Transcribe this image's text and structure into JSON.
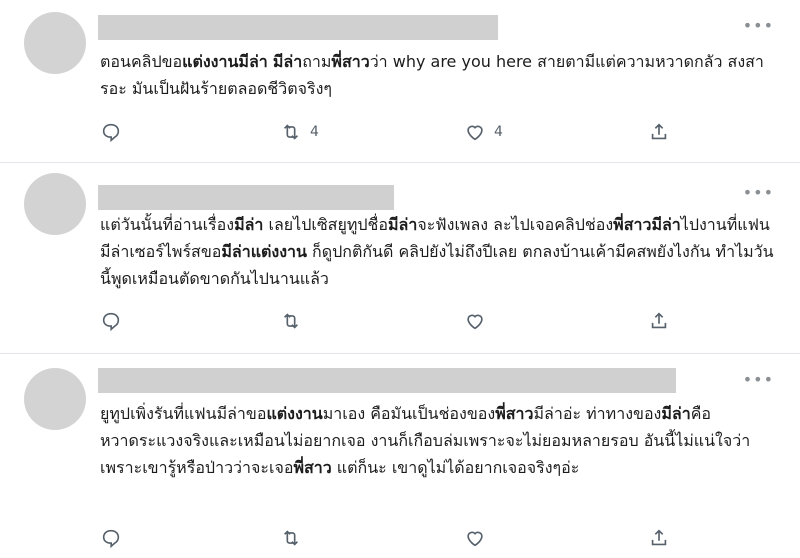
{
  "tweets": [
    {
      "segments": [
        {
          "t": "ตอนคลิปขอ",
          "b": false
        },
        {
          "t": "แต่งงาน",
          "b": true
        },
        {
          "t": "มีล่า",
          "b": true
        },
        {
          "t": " ",
          "b": false
        },
        {
          "t": "มีล่า",
          "b": true
        },
        {
          "t": "ถาม",
          "b": false
        },
        {
          "t": "พี่สาว",
          "b": true
        },
        {
          "t": "ว่า why are you here สายตามีแต่ความหวาดกลัว สงสารอะ มันเป็นฝันร้ายตลอดชีวิตจริงๆ",
          "b": false
        }
      ],
      "reply_count": "",
      "retweet_count": "4",
      "like_count": "4"
    },
    {
      "segments": [
        {
          "t": "แต่วันนั้นที่อ่านเรื่อง",
          "b": false
        },
        {
          "t": "มีล่า",
          "b": true
        },
        {
          "t": " เลยไปเซิสยูทูปชื่อ",
          "b": false
        },
        {
          "t": "มีล่า",
          "b": true
        },
        {
          "t": "จะฟังเพลง ละไปเจอคลิปช่อง",
          "b": false
        },
        {
          "t": "พี่สาว",
          "b": true
        },
        {
          "t": "มีล่า",
          "b": true
        },
        {
          "t": "ไปงานที่แฟนมีล่าเซอร์ไพร์สขอ",
          "b": false
        },
        {
          "t": "มีล่าแต่งงาน",
          "b": true
        },
        {
          "t": " ก็ดูปกติกันดี คลิปยังไม่ถึงปีเลย ตกลงบ้านเค้ามีคสพยังไงกัน ทำไมวันนี้พูดเหมือนตัดขาดกันไปนานแล้ว",
          "b": false
        }
      ],
      "reply_count": "",
      "retweet_count": "",
      "like_count": ""
    },
    {
      "segments": [
        {
          "t": "ยูทูปเพิ่งรันที่แฟนมีล่าขอ",
          "b": false
        },
        {
          "t": "แต่งงาน",
          "b": true
        },
        {
          "t": "มาเอง คือมันเป็นช่องของ",
          "b": false
        },
        {
          "t": "พี่สาว",
          "b": true
        },
        {
          "t": "มีล่าอ่ะ ท่าทางของ",
          "b": false
        },
        {
          "t": "มีล่า",
          "b": true
        },
        {
          "t": "คือหวาดระแวงจริงและเหมือนไม่อยากเจอ งานก็เกือบล่มเพราะจะไม่ยอมหลายรอบ อันนี้ไม่แน่ใจว่าเพราะเขารู้หรือป่าวว่าจะเจอ",
          "b": false
        },
        {
          "t": "พี่สาว",
          "b": true
        },
        {
          "t": " แต่ก็นะ เขาดูไม่ได้อยากเจอจริงๆอ่ะ",
          "b": false
        }
      ],
      "reply_count": "",
      "retweet_count": "",
      "like_count": ""
    }
  ],
  "more_icon": "more-horizontal-icon",
  "action_icons": [
    "reply-icon",
    "retweet-icon",
    "like-icon",
    "share-icon"
  ]
}
